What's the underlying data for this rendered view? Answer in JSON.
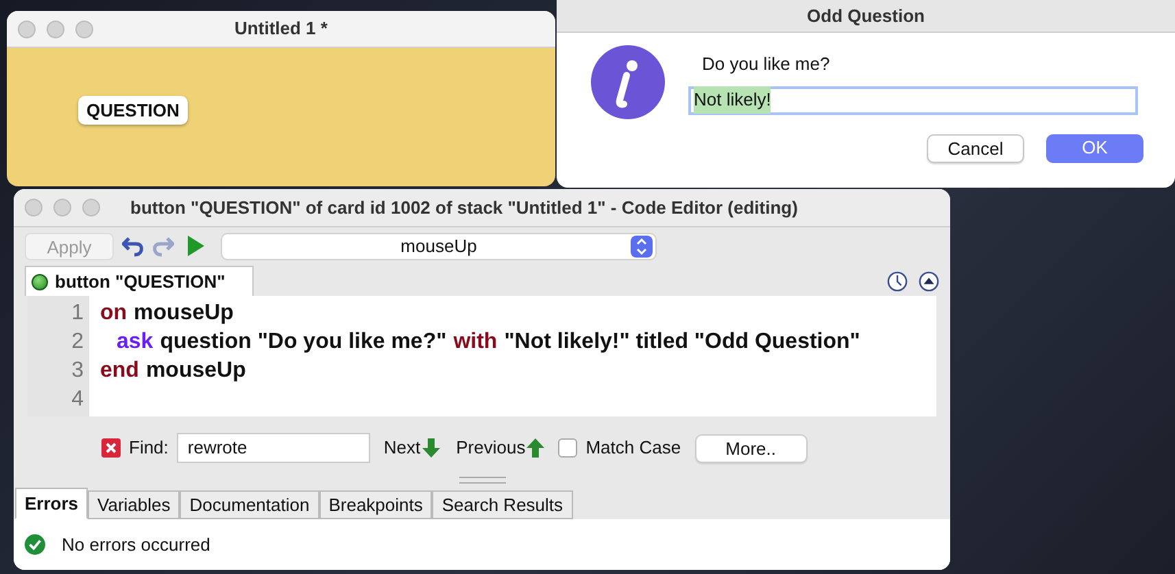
{
  "stack_window": {
    "title": "Untitled 1 *",
    "button": {
      "label": "QUESTION"
    }
  },
  "dialog": {
    "title": "Odd Question",
    "prompt": "Do you like me?",
    "answer": {
      "value": "Not likely!"
    },
    "buttons": [
      {
        "label": "Cancel",
        "kind": "default"
      },
      {
        "label": "OK",
        "kind": "primary"
      }
    ]
  },
  "code_editor": {
    "title": "button \"QUESTION\" of card id 1002 of stack \"Untitled 1\" - Code Editor (editing)",
    "toolbar": {
      "apply": {
        "label": "Apply",
        "disabled": true
      },
      "handler": "mouseUp"
    },
    "script_tab": {
      "label": "button \"QUESTION\""
    },
    "lines": [
      {
        "number": "1",
        "indent": false,
        "tokens": [
          {
            "text": "on",
            "kind": "keyword"
          },
          {
            "text": "mouseUp",
            "kind": "plain"
          }
        ]
      },
      {
        "number": "2",
        "indent": true,
        "tokens": [
          {
            "text": "ask",
            "kind": "command"
          },
          {
            "text": "question \"Do you like me?\"",
            "kind": "plain"
          },
          {
            "text": "with",
            "kind": "keyword"
          },
          {
            "text": "\"Not likely!\" titled \"Odd Question\"",
            "kind": "plain"
          }
        ]
      },
      {
        "number": "3",
        "indent": false,
        "tokens": [
          {
            "text": "end",
            "kind": "keyword"
          },
          {
            "text": "mouseUp",
            "kind": "plain"
          }
        ]
      },
      {
        "number": "4",
        "indent": false
      }
    ],
    "find_bar": {
      "label": "Find:",
      "value": "rewrote",
      "next": "Next",
      "previous": "Previous",
      "match_case": {
        "label": "Match Case",
        "checked": false
      },
      "more": "More.."
    },
    "tabs": [
      {
        "label": "Errors",
        "selected": true
      },
      {
        "label": "Variables",
        "selected": false
      },
      {
        "label": "Documentation",
        "selected": false
      },
      {
        "label": "Breakpoints",
        "selected": false
      },
      {
        "label": "Search Results",
        "selected": false
      }
    ],
    "status": {
      "message": "No errors occurred"
    }
  }
}
